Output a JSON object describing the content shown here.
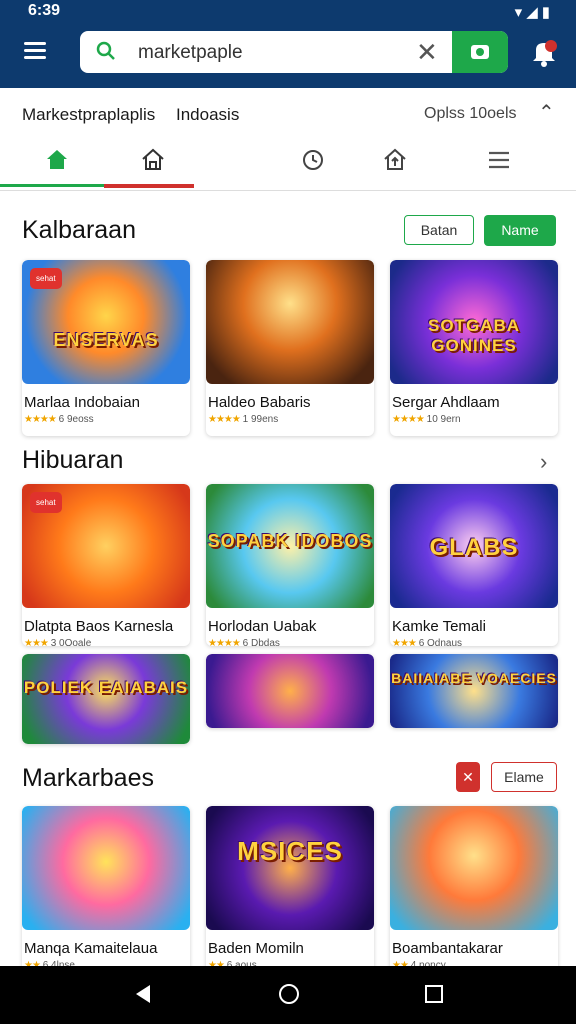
{
  "status_bar": {
    "time": "6:39"
  },
  "search": {
    "value": "marketpaple"
  },
  "subnav": {
    "left_a": "Markestpraplaplis",
    "left_b": "Indoasis",
    "right": "Oplss 10oels"
  },
  "sections": [
    {
      "title": "Kalbaraan",
      "button_outline": "Batan",
      "button_fill": "Name",
      "cards": [
        {
          "name": "Marlaa Indobaian",
          "rating": "6 9eoss",
          "badge": "sehat",
          "art": "ENSERVAS"
        },
        {
          "name": "Haldeo Babaris",
          "rating": "1 99ens",
          "art": ""
        },
        {
          "name": "Sergar Ahdlaam",
          "rating": "10 9ern",
          "art": "SOTGABA GONINES"
        }
      ]
    },
    {
      "title": "Hibuaran",
      "cards": [
        {
          "name": "Dlatpta Baos Karnesla",
          "rating": "3 0Ooale",
          "badge": "sehat",
          "art": ""
        },
        {
          "name": "Horlodan Uabak",
          "rating": "6 Dbdas",
          "art": "SOPABK IDOBOS"
        },
        {
          "name": "Kamke Temali",
          "rating": "6 Odnaus",
          "art": "GLABS"
        },
        {
          "name": "",
          "rating": "",
          "art": "POLIEK EAIABAIS"
        },
        {
          "name": "",
          "rating": "",
          "art": ""
        },
        {
          "name": "",
          "rating": "",
          "art": "BAIIAIABE VOAECIES"
        }
      ]
    },
    {
      "title": "Markarbaes",
      "button_outline": "Elame",
      "cards": [
        {
          "name": "Manqa Kamaitelaua",
          "rating": "6 4lnse",
          "art": ""
        },
        {
          "name": "Baden Momiln",
          "rating": "6 aous",
          "art": "MSICES"
        },
        {
          "name": "Boambantakarar",
          "rating": "4 poncy",
          "art": ""
        }
      ]
    }
  ],
  "colors": {
    "appbar": "#0d3a6e",
    "accent_green": "#1ea84a",
    "accent_red": "#d0312d"
  },
  "icons": {
    "tabs": [
      "home-icon",
      "store-icon",
      "history-icon",
      "upload-icon",
      "menu-icon"
    ]
  }
}
